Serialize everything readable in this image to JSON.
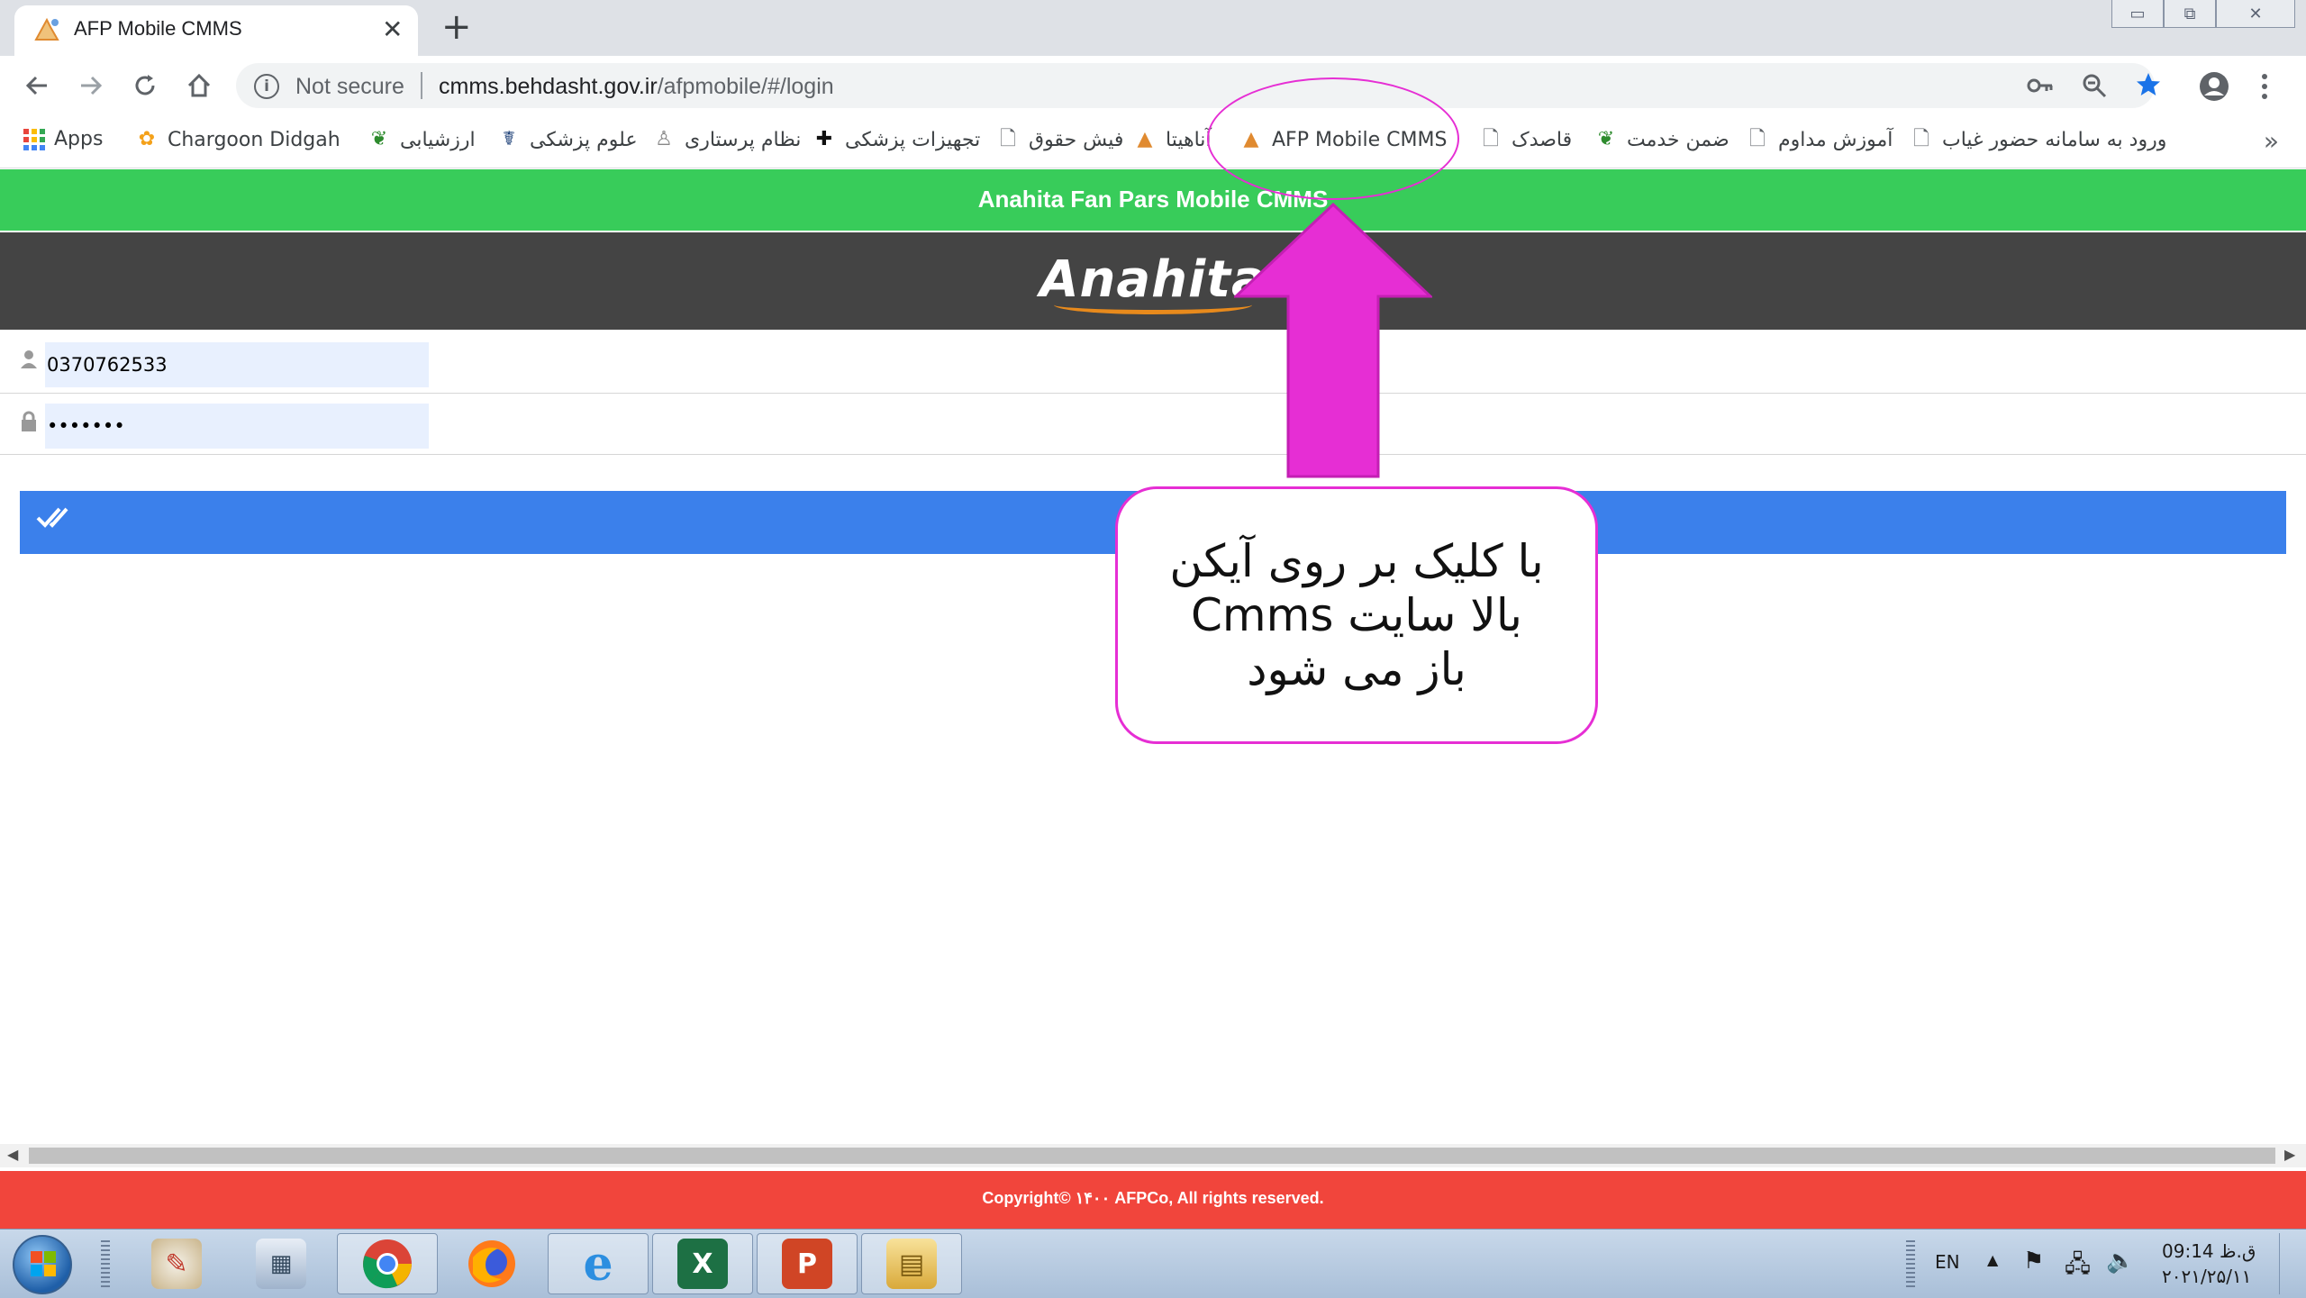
{
  "browser": {
    "tab_title": "AFP Mobile CMMS",
    "tab_close": "✕",
    "new_tab": "+",
    "window_controls": {
      "minimize": "▭",
      "restore": "⧉",
      "close": "✕"
    }
  },
  "omnibox": {
    "security_label": "Not secure",
    "url_host": "cmms.behdasht.gov.ir",
    "url_path": "/afpmobile/#/login"
  },
  "bookmarks": [
    {
      "label": "Apps",
      "icon": "apps-grid-icon"
    },
    {
      "label": "Chargoon Didgah",
      "icon": "chargoon-icon"
    },
    {
      "label": "ارزشیابی",
      "icon": "leaf-icon"
    },
    {
      "label": "علوم پزشکی",
      "icon": "medical-icon"
    },
    {
      "label": "نظام پرستاری",
      "icon": "nurse-icon"
    },
    {
      "label": "تجهیزات پزشکی",
      "icon": "first-aid-icon"
    },
    {
      "label": "فیش حقوق",
      "icon": "page-icon"
    },
    {
      "label": "آناهیتا",
      "icon": "anahita-icon"
    },
    {
      "label": "AFP Mobile CMMS",
      "icon": "anahita-icon"
    },
    {
      "label": "قاصدک",
      "icon": "page-icon"
    },
    {
      "label": "ضمن خدمت",
      "icon": "leaf-icon"
    },
    {
      "label": "آموزش مداوم",
      "icon": "page-icon"
    },
    {
      "label": "ورود به سامانه حضور غیاب",
      "icon": "page-icon"
    }
  ],
  "bookmarks_more": "»",
  "page": {
    "header_title": "Anahita Fan Pars Mobile CMMS",
    "logo_text": "Anahita",
    "username_value": "0370762533",
    "password_value": "•••••••",
    "login_icon": "✔✔",
    "footer_text": "Copyright© ۱۴۰۰ AFPCo, All rights reserved."
  },
  "annotation": {
    "callout_text": "با  کلیک بر روی  آیکن\nبالا  سایت Cmms\nباز می شود",
    "accent_color": "#e62ed4"
  },
  "taskbar": {
    "language": "EN",
    "time": "09:14 ق.ظ",
    "date": "۲۰۲۱/۲۵/۱۱"
  },
  "colors": {
    "header_green": "#38cc5a",
    "header_dark": "#444444",
    "login_blue": "#3b80eb",
    "footer_red": "#f1453c"
  }
}
